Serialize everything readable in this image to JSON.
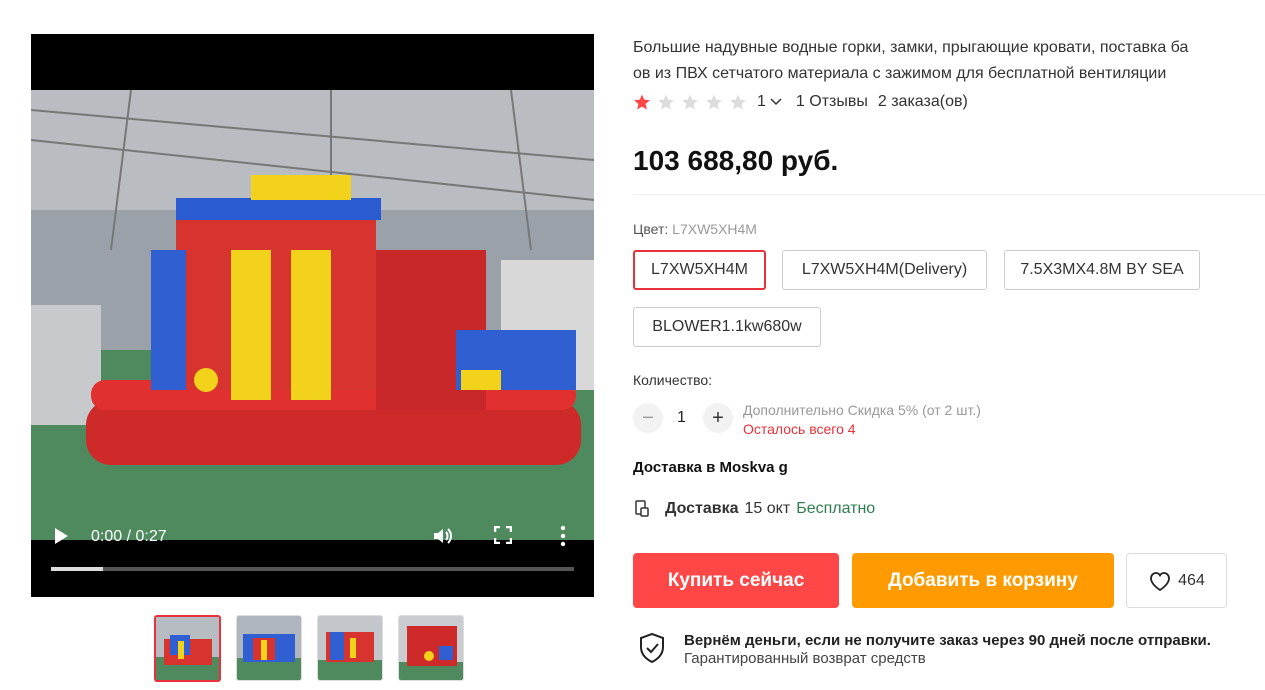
{
  "video": {
    "time": "0:00 / 0:27",
    "progress_fraction": 0.1
  },
  "thumbnails": [
    {
      "name": "thumb-1",
      "active": true
    },
    {
      "name": "thumb-2",
      "active": false
    },
    {
      "name": "thumb-3",
      "active": false
    },
    {
      "name": "thumb-4",
      "active": false
    }
  ],
  "product": {
    "title_line1": "Большие надувные водные горки, замки, прыгающие кровати, поставка ба",
    "title_line2": "ов из ПВХ сетчатого материала с зажимом для бесплатной вентиляции",
    "rating_value": "1",
    "rating_stars": 1,
    "reviews": "1 Отзывы",
    "orders": "2 заказа(ов)",
    "price": "103 688,80 руб."
  },
  "color": {
    "label": "Цвет:",
    "selected": "L7XW5XH4M",
    "options": [
      "L7XW5XH4M",
      "L7XW5XH4M(Delivery)",
      "7.5X3MX4.8M BY SEA",
      "BLOWER1.1kw680w"
    ]
  },
  "quantity": {
    "label": "Количество:",
    "minus": "−",
    "plus": "+",
    "value": "1",
    "discount": "Дополнительно Скидка 5% (от 2 шт.)",
    "stock": "Осталось всего 4"
  },
  "shipping": {
    "ship_to": "Доставка в Moskva g",
    "label": "Доставка",
    "date": "15 окт",
    "price": "Бесплатно"
  },
  "actions": {
    "buy": "Купить сейчас",
    "cart": "Добавить в корзину",
    "wishlist_count": "464"
  },
  "guarantee": {
    "line1": "Вернём деньги, если не получите заказ через 90 дней после отправки.",
    "line2": "Гарантированный возврат средств"
  },
  "colors": {
    "accent_red": "#ff4747",
    "accent_orange": "#ff9a00",
    "free_green": "#2e7d4f"
  }
}
